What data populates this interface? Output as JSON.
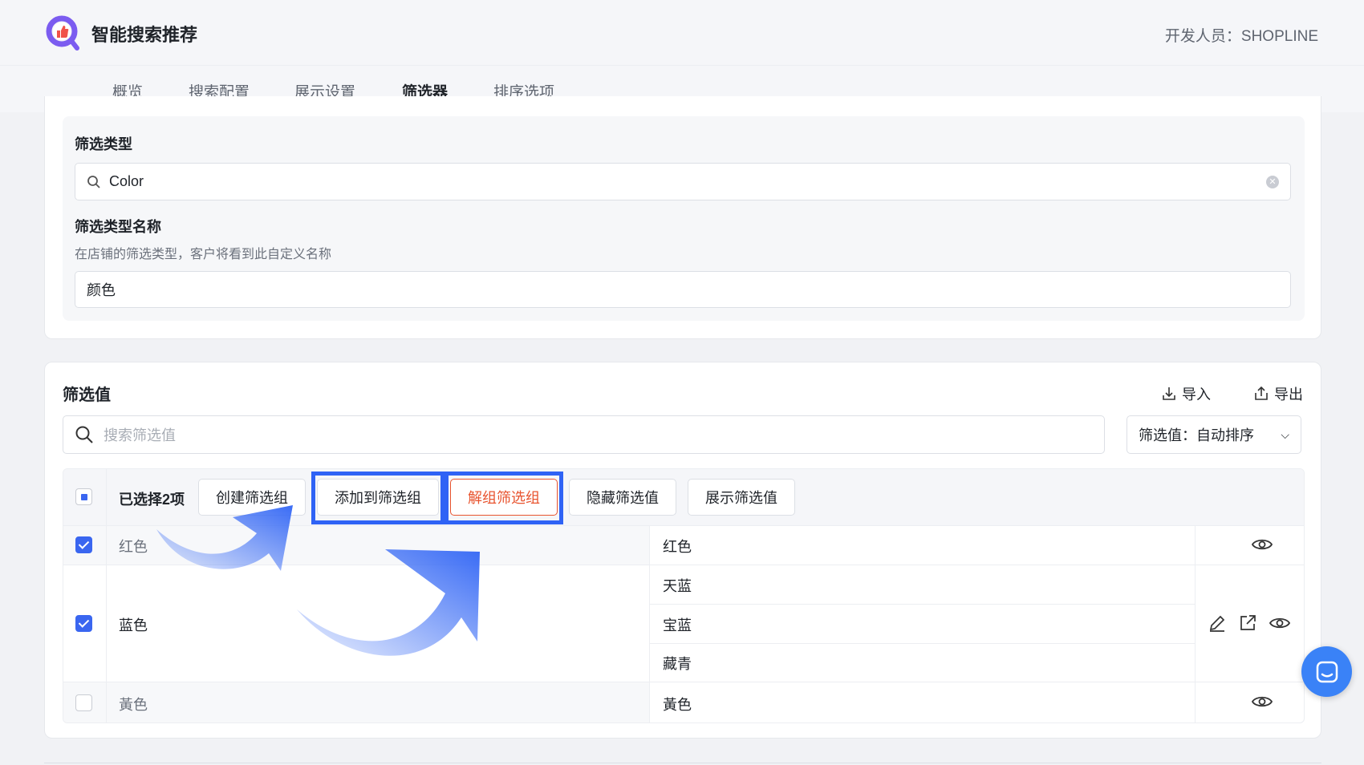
{
  "header": {
    "app_title": "智能搜索推荐",
    "developer": "开发人员：SHOPLINE"
  },
  "tabs": [
    {
      "label": "概览"
    },
    {
      "label": "搜索配置"
    },
    {
      "label": "展示设置"
    },
    {
      "label": "筛选器",
      "active": true
    },
    {
      "label": "排序选项"
    }
  ],
  "filter_type": {
    "label": "筛选类型",
    "value": "Color"
  },
  "filter_name": {
    "label": "筛选类型名称",
    "hint": "在店铺的筛选类型，客户将看到此自定义名称",
    "value": "颜色"
  },
  "filter_values": {
    "title": "筛选值",
    "import": "导入",
    "export": "导出",
    "search_placeholder": "搜索筛选值",
    "sort_select": "筛选值：自动排序",
    "selected_text": "已选择2项",
    "actions": [
      "创建筛选组",
      "添加到筛选组",
      "解组筛选组",
      "隐藏筛选值",
      "展示筛选值"
    ],
    "rows": [
      {
        "name": "红色",
        "checked": true,
        "values": [
          "红色"
        ]
      },
      {
        "name": "蓝色",
        "checked": true,
        "values": [
          "天蓝",
          "宝蓝",
          "藏青"
        ]
      },
      {
        "name": "黃色",
        "checked": false,
        "values": [
          "黃色"
        ]
      }
    ]
  },
  "colors": {
    "accent": "#3a66f0",
    "danger": "#e8542f"
  }
}
